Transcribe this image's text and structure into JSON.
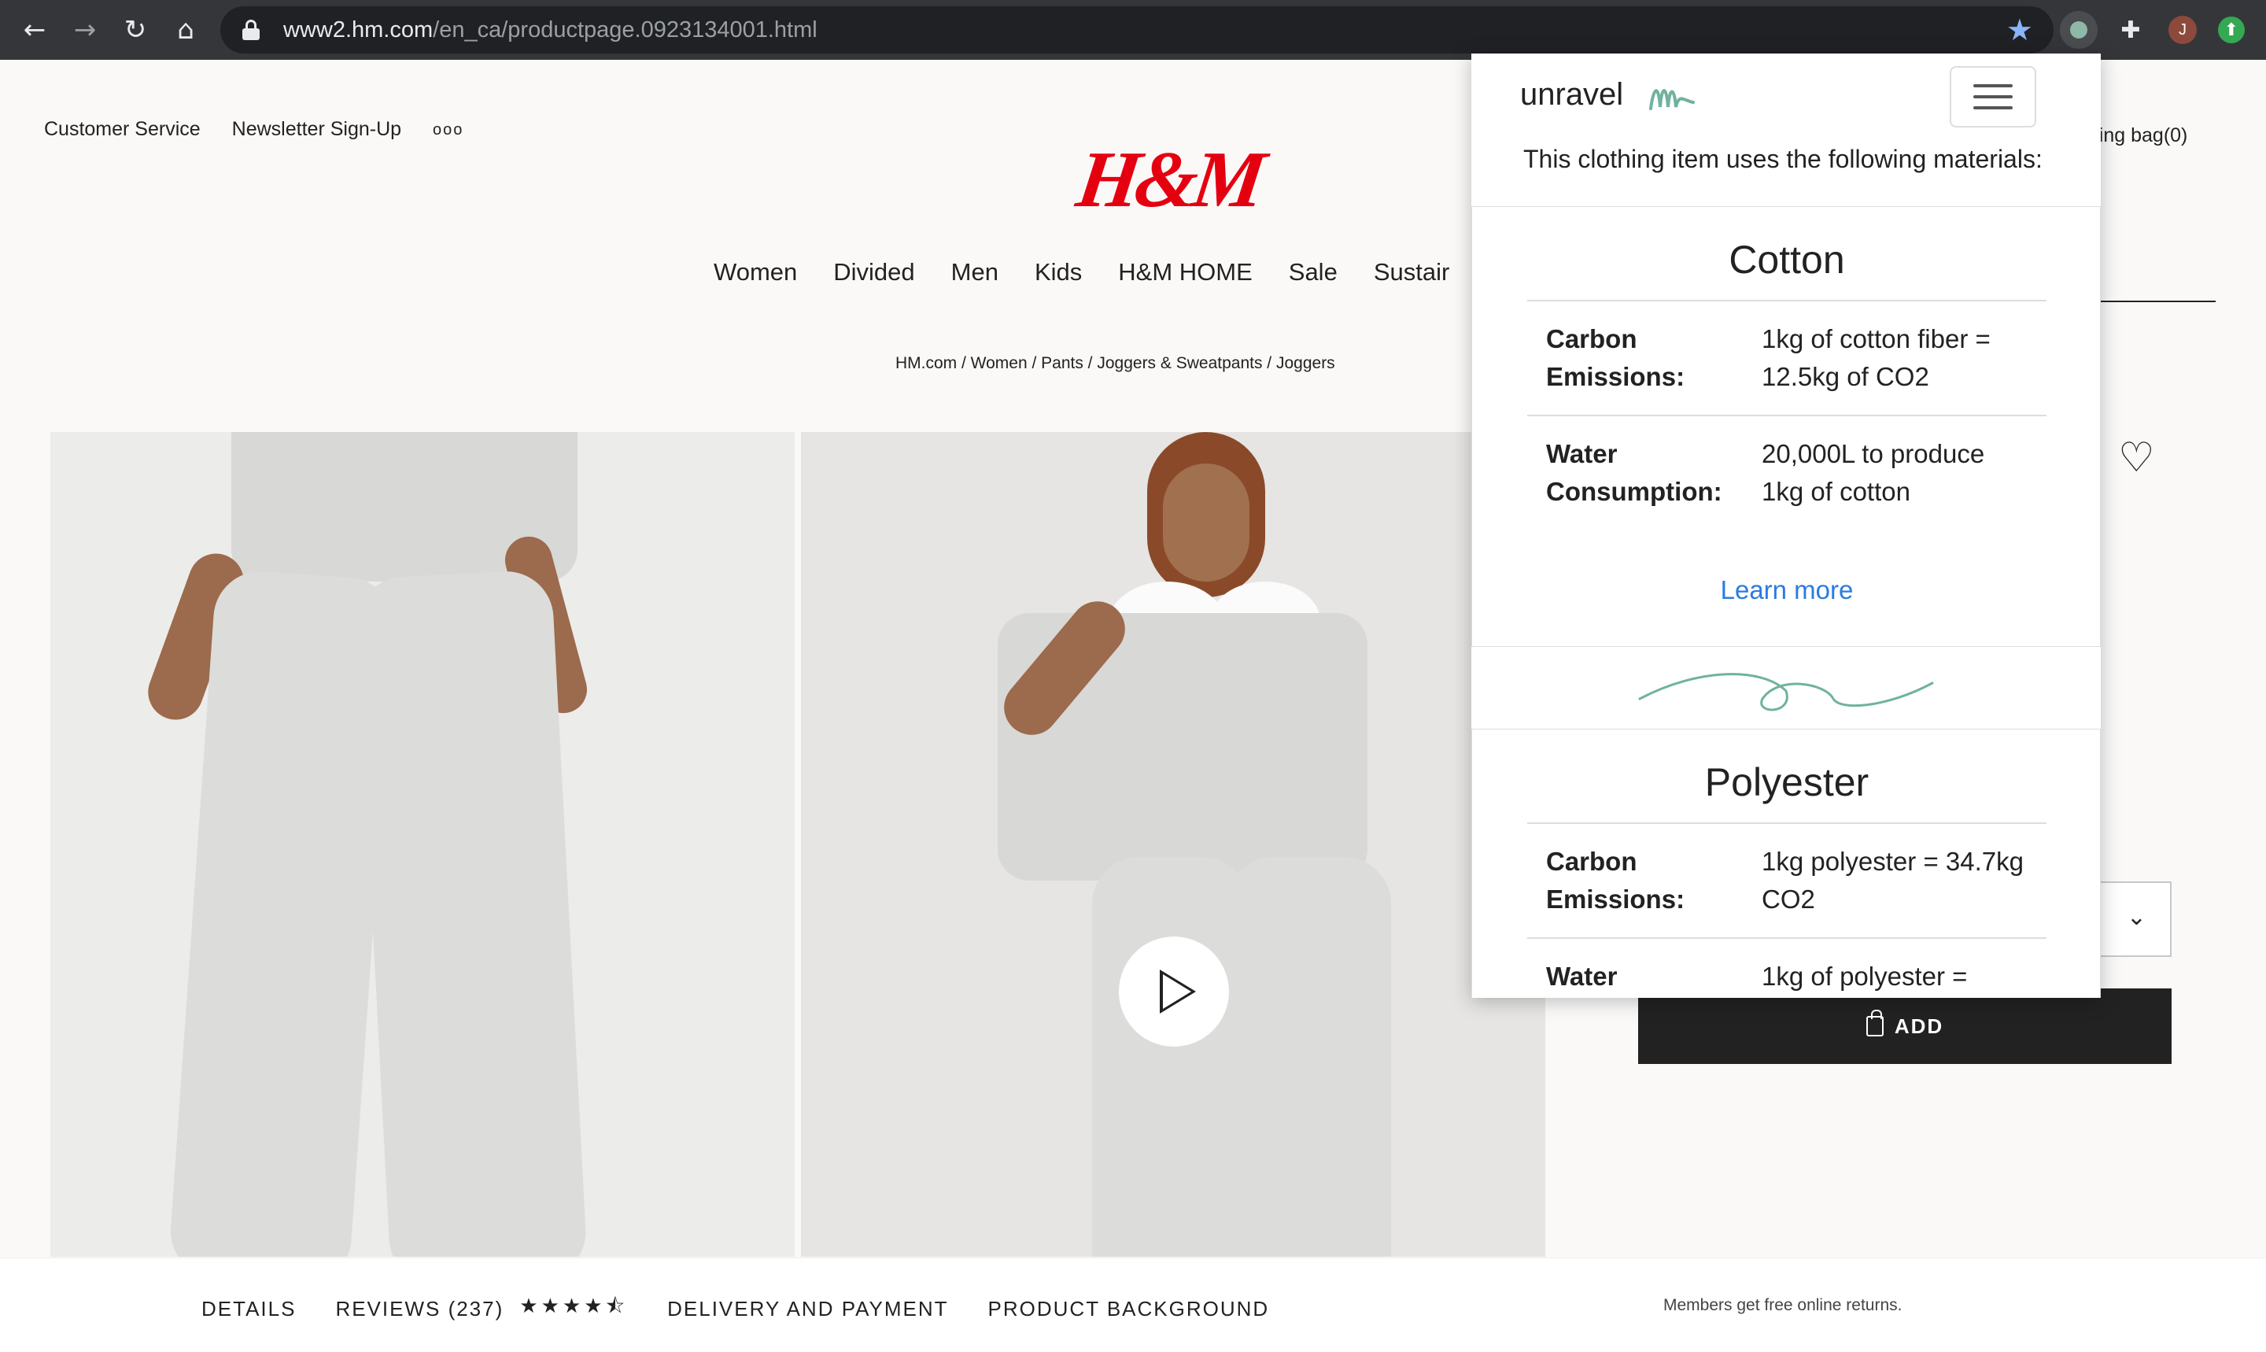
{
  "browser": {
    "url_host": "www2.hm.com",
    "url_path": "/en_ca/productpage.0923134001.html",
    "avatar_letter": "J"
  },
  "header": {
    "top_links": [
      "Customer Service",
      "Newsletter Sign-Up"
    ],
    "more_label": "ooo",
    "logo": "H&M",
    "bag_label": "pping bag(0)"
  },
  "main_nav": [
    "Women",
    "Divided",
    "Men",
    "Kids",
    "H&M HOME",
    "Sale",
    "Sustair"
  ],
  "breadcrumb": "HM.com / Women / Pants / Joggers & Sweatpants / Joggers",
  "product": {
    "add_label": "ADD",
    "stars": "★★★★⯪"
  },
  "bottom_tabs": {
    "details": "DETAILS",
    "reviews": "REVIEWS (237)",
    "delivery": "DELIVERY AND PAYMENT",
    "background": "PRODUCT BACKGROUND",
    "returns_note": "Members get free online returns."
  },
  "popup": {
    "brand": "unravel",
    "intro": "This clothing item uses the following materials:",
    "materials": [
      {
        "name": "Cotton",
        "carbon_label_1": "Carbon",
        "carbon_label_2": "Emissions:",
        "carbon_value_1": "1kg of cotton fiber =",
        "carbon_value_2": "12.5kg of CO2",
        "water_label_1": "Water",
        "water_label_2": "Consumption:",
        "water_value_1": "20,000L to produce",
        "water_value_2": "1kg of cotton",
        "learn_more": "Learn more"
      },
      {
        "name": "Polyester",
        "carbon_label_1": "Carbon",
        "carbon_label_2": "Emissions:",
        "carbon_value_1": "1kg polyester = 34.7kg",
        "carbon_value_2": "CO2",
        "water_label_1": "Water",
        "water_value_1": "1kg of polyester ="
      }
    ]
  },
  "colors": {
    "hm_red": "#e50010",
    "link_blue": "#2b7be0",
    "unravel_teal": "#6fb2a0"
  }
}
